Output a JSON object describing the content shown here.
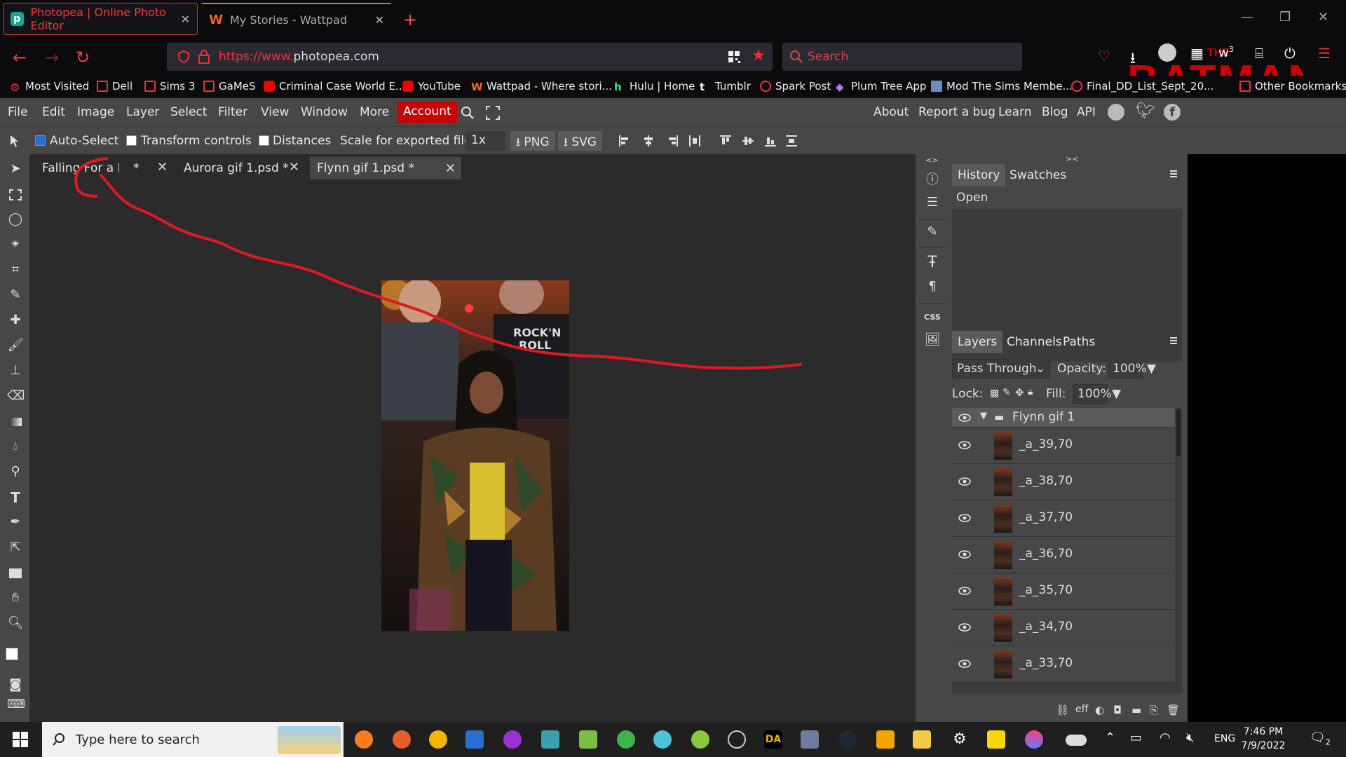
{
  "browser": {
    "tabs": [
      {
        "title": "Photopea | Online Photo Editor",
        "active": true
      },
      {
        "title": "My Stories - Wattpad",
        "active": false
      }
    ],
    "url_prefix": "https://www.",
    "url_domain": "photopea.com",
    "search_placeholder": "Search",
    "badge_count": "3",
    "bookmarks": [
      "Most Visited",
      "Dell",
      "Sims 3",
      "GaMeS",
      "Criminal Case World E...",
      "YouTube",
      "Wattpad - Where stori...",
      "Hulu | Home",
      "Tumblr",
      "Spark Post",
      "Plum Tree App",
      "Mod The Sims Membe...",
      "Final_DD_List_Sept_20...",
      "Other Bookmarks"
    ]
  },
  "menu": {
    "items": [
      "File",
      "Edit",
      "Image",
      "Layer",
      "Select",
      "Filter",
      "View",
      "Window",
      "More"
    ],
    "account": "Account",
    "right_items": [
      "About",
      "Report a bug",
      "Learn",
      "Blog",
      "API"
    ]
  },
  "options": {
    "auto_select": "Auto-Select",
    "transform_controls": "Transform controls",
    "distances": "Distances",
    "scale_label": "Scale for exported files:",
    "scale_value": "1x",
    "png": "PNG",
    "svg": "SVG"
  },
  "documents": [
    {
      "name": "Falling For a Lifer",
      "modified": "*"
    },
    {
      "name": "Aurora gif 1.psd",
      "modified": "*"
    },
    {
      "name": "Flynn gif 1.psd",
      "modified": "*"
    }
  ],
  "history": {
    "tabs": [
      "History",
      "Swatches"
    ],
    "entries": [
      "Open"
    ]
  },
  "layers": {
    "tabs": [
      "Layers",
      "Channels",
      "Paths"
    ],
    "blend_mode": "Pass Through",
    "opacity_label": "Opacity:",
    "opacity": "100%",
    "lock_label": "Lock:",
    "fill_label": "Fill:",
    "fill": "100%",
    "group": "Flynn gif 1",
    "items": [
      "_a_39,70",
      "_a_38,70",
      "_a_37,70",
      "_a_36,70",
      "_a_35,70",
      "_a_34,70",
      "_a_33,70"
    ]
  },
  "taskbar": {
    "search_placeholder": "Type here to search",
    "lang": "ENG",
    "time": "7:46 PM",
    "date": "7/9/2022",
    "notif": "2"
  },
  "colors": {
    "accent": "#c90000",
    "annotation": "#e0191f"
  }
}
